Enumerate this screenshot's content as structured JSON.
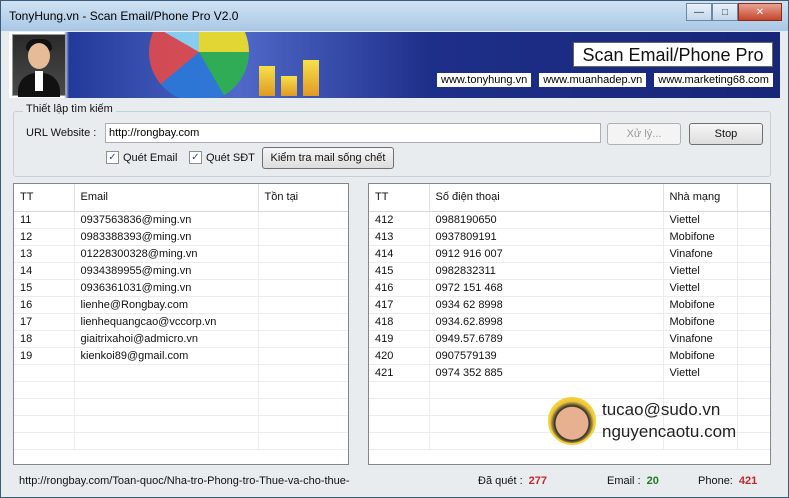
{
  "window": {
    "title": "TonyHung.vn - Scan Email/Phone Pro V2.0"
  },
  "banner": {
    "title": "Scan Email/Phone Pro",
    "links": [
      "www.tonyhung.vn",
      "www.muanhadep.vn",
      "www.marketing68.com"
    ]
  },
  "settings": {
    "group_label": "Thiết lập tìm kiếm",
    "url_label": "URL Website :",
    "url_value": "http://rongbay.com",
    "process_button": "Xử lý...",
    "stop_button": "Stop",
    "scan_email_label": "Quét Email",
    "scan_email_checked": true,
    "scan_phone_label": "Quét SĐT",
    "scan_phone_checked": true,
    "check_mail_button": "Kiểm tra mail sống chết"
  },
  "email_table": {
    "headers": [
      "TT",
      "Email",
      "Tồn tại"
    ],
    "rows": [
      [
        "11",
        "0937563836@ming.vn",
        ""
      ],
      [
        "12",
        "0983388393@ming.vn",
        ""
      ],
      [
        "13",
        "01228300328@ming.vn",
        ""
      ],
      [
        "14",
        "0934389955@ming.vn",
        ""
      ],
      [
        "15",
        "0936361031@ming.vn",
        ""
      ],
      [
        "16",
        "lienhe@Rongbay.com",
        ""
      ],
      [
        "17",
        "lienhequangcao@vccorp.vn",
        ""
      ],
      [
        "18",
        "giaitrixahoi@admicro.vn",
        ""
      ],
      [
        "19",
        "kienkoi89@gmail.com",
        ""
      ]
    ]
  },
  "phone_table": {
    "headers": [
      "TT",
      "Số điện thoại",
      "Nhà mạng"
    ],
    "rows": [
      [
        "412",
        "0988190650",
        "Viettel"
      ],
      [
        "413",
        "0937809191",
        "Mobifone"
      ],
      [
        "414",
        "0912 916 007",
        "Vinafone"
      ],
      [
        "415",
        "0982832311",
        "Viettel"
      ],
      [
        "416",
        "0972 151 468",
        "Viettel"
      ],
      [
        "417",
        "0934 62 8998",
        "Mobifone"
      ],
      [
        "418",
        "0934.62.8998",
        "Mobifone"
      ],
      [
        "419",
        "0949.57.6789",
        "Vinafone"
      ],
      [
        "420",
        "0907579139",
        "Mobifone"
      ],
      [
        "421",
        "0974 352 885",
        "Viettel"
      ]
    ]
  },
  "overlay": {
    "line1": "tucao@sudo.vn",
    "line2": "nguyencaotu.com"
  },
  "status": {
    "current_url": "http://rongbay.com/Toan-quoc/Nha-tro-Phong-tro-Thue-va-cho-thue-",
    "scanned_label": "Đã quét :",
    "scanned_value": "277",
    "email_label": "Email :",
    "email_value": "20",
    "phone_label": "Phone:",
    "phone_value": "421"
  },
  "colors": {
    "scanned": "#c0282d",
    "email_count": "#1f7a1f",
    "phone_count": "#c0282d"
  }
}
